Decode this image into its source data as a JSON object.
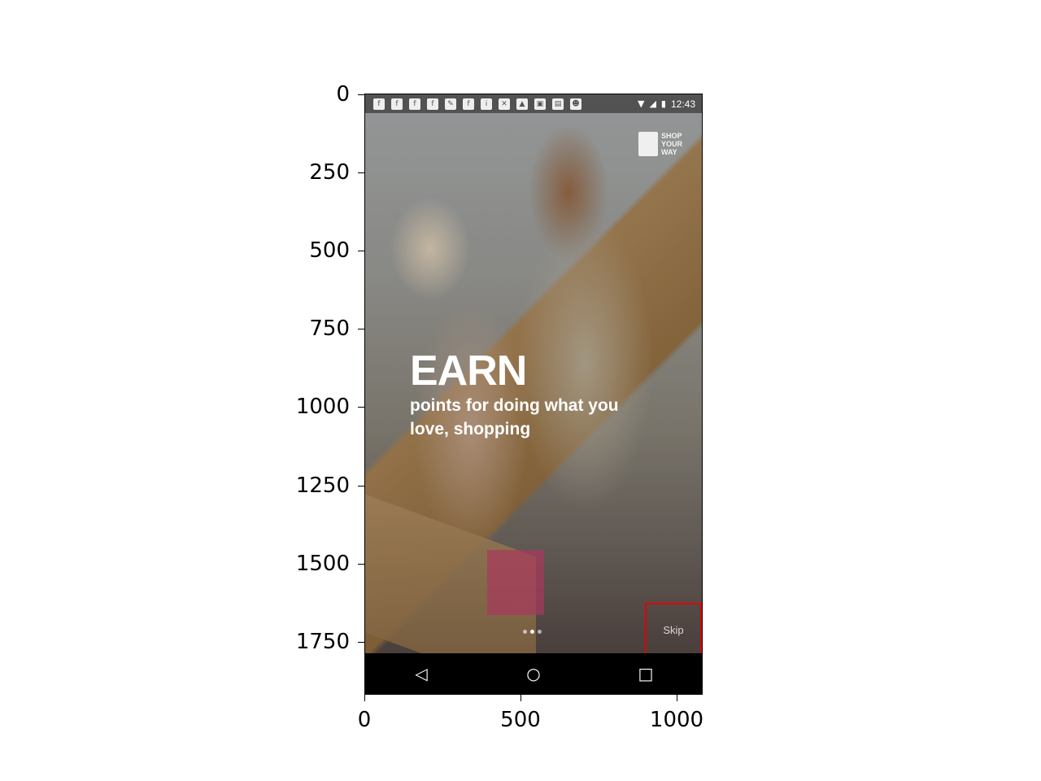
{
  "plot": {
    "y_ticks": [
      "0",
      "250",
      "500",
      "750",
      "1000",
      "1250",
      "1500",
      "1750"
    ],
    "x_ticks": [
      "0",
      "500",
      "1000"
    ]
  },
  "status_bar": {
    "time": "12:43"
  },
  "logo": {
    "line1": "SHOP",
    "line2": "YOUR",
    "line3": "WAY"
  },
  "onboarding": {
    "title": "EARN",
    "subtitle": "points for doing what you love, shopping",
    "page_count": 3,
    "active_page": 2
  },
  "skip_button": {
    "label": "Skip",
    "highlight_color": "#e00000"
  },
  "nav_bar": {
    "back_icon": "◁",
    "home_icon": "○",
    "recents_icon": "□"
  }
}
